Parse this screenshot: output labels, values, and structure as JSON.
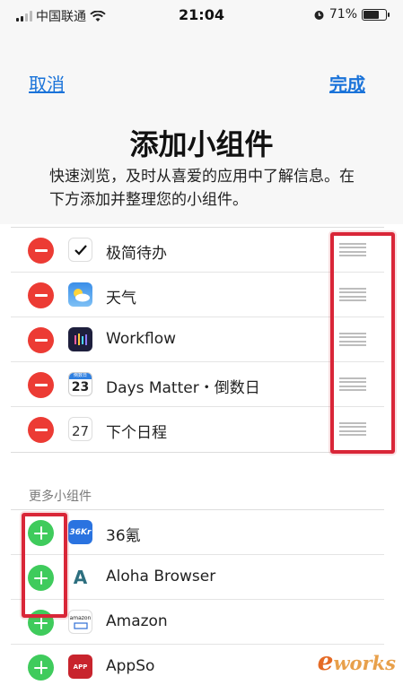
{
  "status_bar": {
    "carrier": "中国联通",
    "time": "21:04",
    "battery": "71%"
  },
  "nav": {
    "cancel": "取消",
    "done": "完成"
  },
  "header": {
    "title": "添加小组件",
    "description": "快速浏览，及时从喜爱的应用中了解信息。在下方添加并整理您的小组件。"
  },
  "active_widgets": [
    {
      "label": "极简待办",
      "icon": "checkmark-icon"
    },
    {
      "label": "天气",
      "icon": "weather-icon"
    },
    {
      "label": "Workflow",
      "icon": "workflow-icon"
    },
    {
      "label": "Days Matter・倒数日",
      "icon": "calendar-23-icon"
    },
    {
      "label": "下个日程",
      "icon": "calendar-27-icon"
    }
  ],
  "calendar_icon_23": {
    "month": "倒数日",
    "day": "23"
  },
  "calendar_icon_27": {
    "day": "27"
  },
  "more_section": {
    "label": "更多小组件",
    "items": [
      {
        "label": "36氪",
        "icon": "36kr-icon",
        "icon_text": "36Kr"
      },
      {
        "label": "Aloha Browser",
        "icon": "aloha-icon",
        "icon_text": "A"
      },
      {
        "label": "Amazon",
        "icon": "amazon-icon",
        "icon_text": "amazon"
      },
      {
        "label": "AppSo",
        "icon": "appso-icon",
        "icon_text": "APP"
      }
    ]
  },
  "watermark": {
    "prefix": "e",
    "text": "works"
  },
  "colors": {
    "accent": "#1a73d9",
    "remove": "#ec3b34",
    "add": "#3fcb5c",
    "highlight_box": "#d92638"
  }
}
